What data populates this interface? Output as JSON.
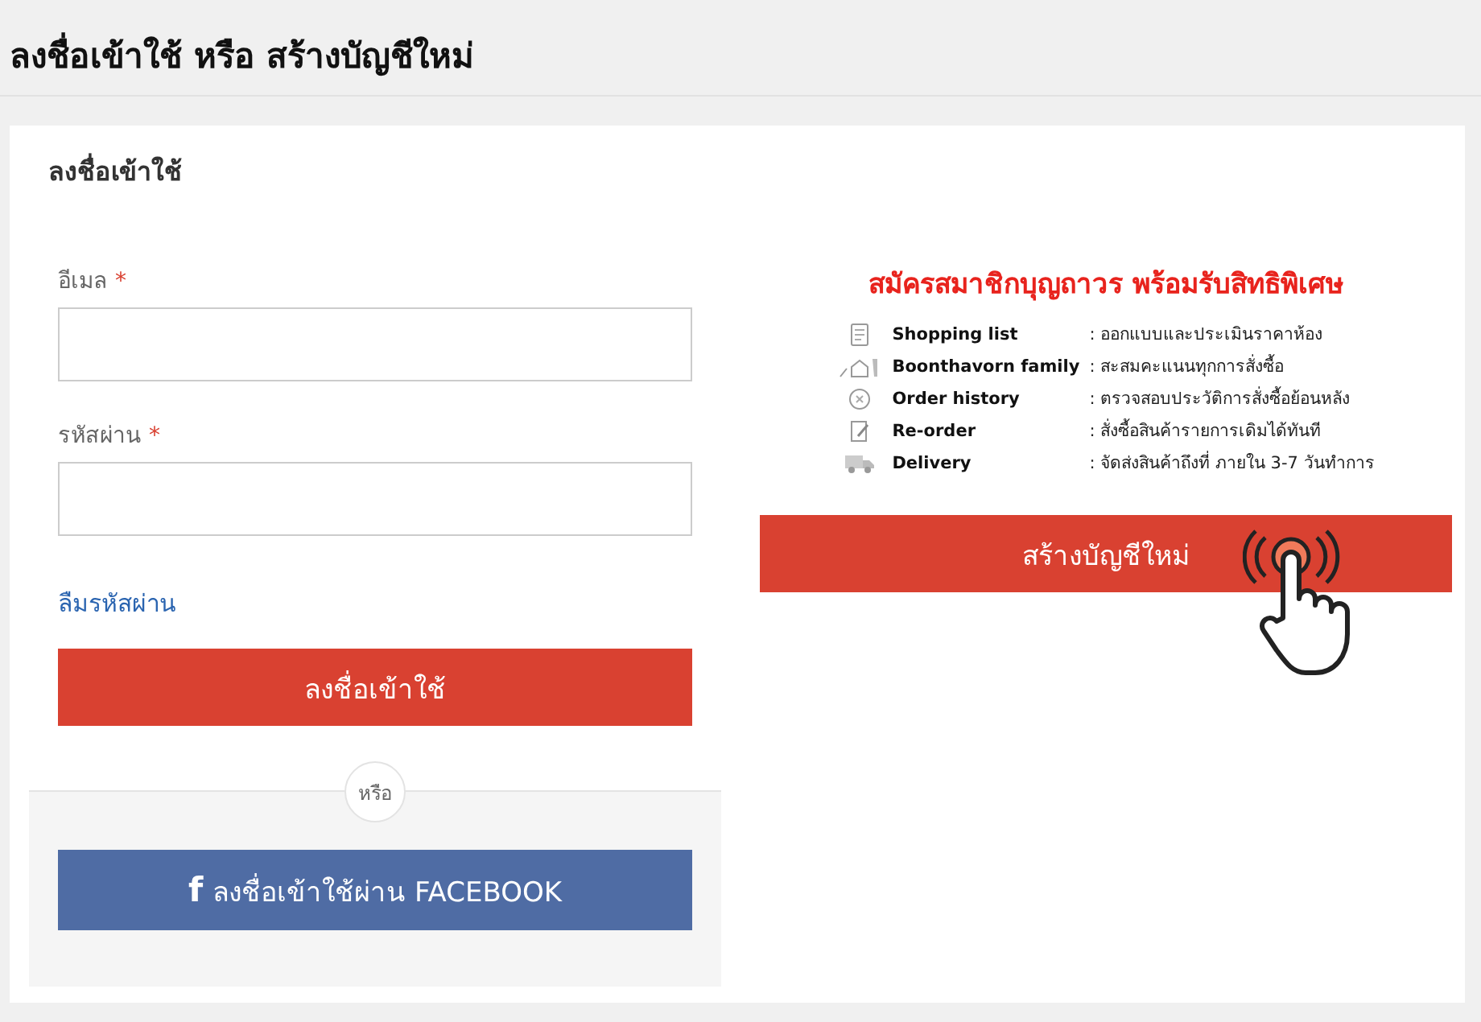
{
  "page_title": "ลงชื่อเข้าใช้ หรือ สร้างบัญชีใหม่",
  "login": {
    "heading": "ลงชื่อเข้าใช้",
    "fields": [
      {
        "label": "อีเมล",
        "required_mark": "*"
      },
      {
        "label": "รหัสผ่าน",
        "required_mark": "*"
      }
    ],
    "forgot_link": "ลืมรหัสผ่าน",
    "submit": "ลงชื่อเข้าใช้",
    "divider": "หรือ",
    "facebook_icon": "f",
    "facebook_button": "ลงชื่อเข้าใช้ผ่าน FACEBOOK"
  },
  "register": {
    "headline": "สมัครสมาชิกบุญถาวร พร้อมรับสิทธิพิเศษ",
    "benefits": [
      {
        "name": "Shopping list",
        "desc": ": ออกแบบและประเมินราคาห้อง"
      },
      {
        "name": "Boonthavorn family",
        "desc": ": สะสมคะแนนทุกการสั่งซื้อ"
      },
      {
        "name": "Order history",
        "desc": ": ตรวจสอบประวัติการสั่งซื้อย้อนหลัง"
      },
      {
        "name": "Re-order",
        "desc": ": สั่งซื้อสินค้ารายการเดิมได้ทันที"
      },
      {
        "name": "Delivery",
        "desc": ": จัดส่งสินค้าถึงที่ ภายใน 3-7 วันทำการ"
      }
    ],
    "button": "สร้างบัญชีใหม่"
  }
}
